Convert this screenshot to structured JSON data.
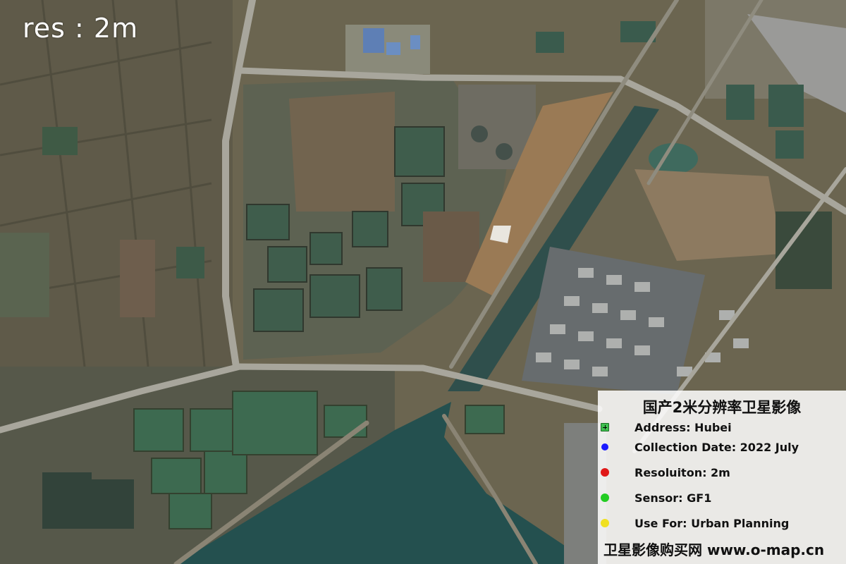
{
  "map": {
    "resolution_label": "res : 2m",
    "legend": {
      "title": "国产2米分辨率卫星影像",
      "items": [
        {
          "label": "Address: Hubei",
          "marker": "address-marker-icon",
          "color": "#3fbf4f"
        },
        {
          "label": "Collection Date: 2022 July",
          "marker": "dot",
          "color": "#1a1aff"
        },
        {
          "label": "Resoluiton: 2m",
          "marker": "dot",
          "color": "#e01818"
        },
        {
          "label": "Sensor: GF1",
          "marker": "dot",
          "color": "#22cc22"
        },
        {
          "label": "Use For: Urban Planning",
          "marker": "dot",
          "color": "#f0e020"
        }
      ],
      "footer": "卫星影像购买网 www.o-map.cn"
    }
  }
}
